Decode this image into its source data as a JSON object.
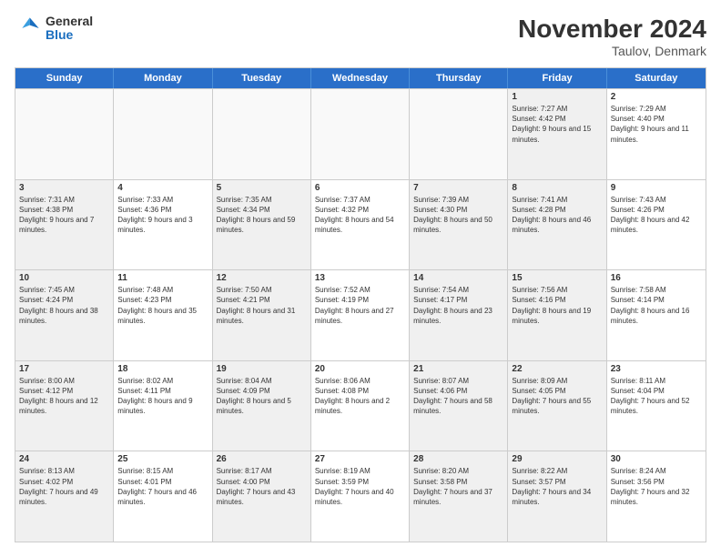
{
  "logo": {
    "line1": "General",
    "line2": "Blue"
  },
  "header": {
    "title": "November 2024",
    "subtitle": "Taulov, Denmark"
  },
  "weekdays": [
    "Sunday",
    "Monday",
    "Tuesday",
    "Wednesday",
    "Thursday",
    "Friday",
    "Saturday"
  ],
  "rows": [
    [
      {
        "day": "",
        "info": "",
        "empty": true
      },
      {
        "day": "",
        "info": "",
        "empty": true
      },
      {
        "day": "",
        "info": "",
        "empty": true
      },
      {
        "day": "",
        "info": "",
        "empty": true
      },
      {
        "day": "",
        "info": "",
        "empty": true
      },
      {
        "day": "1",
        "info": "Sunrise: 7:27 AM\nSunset: 4:42 PM\nDaylight: 9 hours and 15 minutes.",
        "shaded": true
      },
      {
        "day": "2",
        "info": "Sunrise: 7:29 AM\nSunset: 4:40 PM\nDaylight: 9 hours and 11 minutes.",
        "shaded": false
      }
    ],
    [
      {
        "day": "3",
        "info": "Sunrise: 7:31 AM\nSunset: 4:38 PM\nDaylight: 9 hours and 7 minutes.",
        "shaded": true
      },
      {
        "day": "4",
        "info": "Sunrise: 7:33 AM\nSunset: 4:36 PM\nDaylight: 9 hours and 3 minutes.",
        "shaded": false
      },
      {
        "day": "5",
        "info": "Sunrise: 7:35 AM\nSunset: 4:34 PM\nDaylight: 8 hours and 59 minutes.",
        "shaded": true
      },
      {
        "day": "6",
        "info": "Sunrise: 7:37 AM\nSunset: 4:32 PM\nDaylight: 8 hours and 54 minutes.",
        "shaded": false
      },
      {
        "day": "7",
        "info": "Sunrise: 7:39 AM\nSunset: 4:30 PM\nDaylight: 8 hours and 50 minutes.",
        "shaded": true
      },
      {
        "day": "8",
        "info": "Sunrise: 7:41 AM\nSunset: 4:28 PM\nDaylight: 8 hours and 46 minutes.",
        "shaded": true
      },
      {
        "day": "9",
        "info": "Sunrise: 7:43 AM\nSunset: 4:26 PM\nDaylight: 8 hours and 42 minutes.",
        "shaded": false
      }
    ],
    [
      {
        "day": "10",
        "info": "Sunrise: 7:45 AM\nSunset: 4:24 PM\nDaylight: 8 hours and 38 minutes.",
        "shaded": true
      },
      {
        "day": "11",
        "info": "Sunrise: 7:48 AM\nSunset: 4:23 PM\nDaylight: 8 hours and 35 minutes.",
        "shaded": false
      },
      {
        "day": "12",
        "info": "Sunrise: 7:50 AM\nSunset: 4:21 PM\nDaylight: 8 hours and 31 minutes.",
        "shaded": true
      },
      {
        "day": "13",
        "info": "Sunrise: 7:52 AM\nSunset: 4:19 PM\nDaylight: 8 hours and 27 minutes.",
        "shaded": false
      },
      {
        "day": "14",
        "info": "Sunrise: 7:54 AM\nSunset: 4:17 PM\nDaylight: 8 hours and 23 minutes.",
        "shaded": true
      },
      {
        "day": "15",
        "info": "Sunrise: 7:56 AM\nSunset: 4:16 PM\nDaylight: 8 hours and 19 minutes.",
        "shaded": true
      },
      {
        "day": "16",
        "info": "Sunrise: 7:58 AM\nSunset: 4:14 PM\nDaylight: 8 hours and 16 minutes.",
        "shaded": false
      }
    ],
    [
      {
        "day": "17",
        "info": "Sunrise: 8:00 AM\nSunset: 4:12 PM\nDaylight: 8 hours and 12 minutes.",
        "shaded": true
      },
      {
        "day": "18",
        "info": "Sunrise: 8:02 AM\nSunset: 4:11 PM\nDaylight: 8 hours and 9 minutes.",
        "shaded": false
      },
      {
        "day": "19",
        "info": "Sunrise: 8:04 AM\nSunset: 4:09 PM\nDaylight: 8 hours and 5 minutes.",
        "shaded": true
      },
      {
        "day": "20",
        "info": "Sunrise: 8:06 AM\nSunset: 4:08 PM\nDaylight: 8 hours and 2 minutes.",
        "shaded": false
      },
      {
        "day": "21",
        "info": "Sunrise: 8:07 AM\nSunset: 4:06 PM\nDaylight: 7 hours and 58 minutes.",
        "shaded": true
      },
      {
        "day": "22",
        "info": "Sunrise: 8:09 AM\nSunset: 4:05 PM\nDaylight: 7 hours and 55 minutes.",
        "shaded": true
      },
      {
        "day": "23",
        "info": "Sunrise: 8:11 AM\nSunset: 4:04 PM\nDaylight: 7 hours and 52 minutes.",
        "shaded": false
      }
    ],
    [
      {
        "day": "24",
        "info": "Sunrise: 8:13 AM\nSunset: 4:02 PM\nDaylight: 7 hours and 49 minutes.",
        "shaded": true
      },
      {
        "day": "25",
        "info": "Sunrise: 8:15 AM\nSunset: 4:01 PM\nDaylight: 7 hours and 46 minutes.",
        "shaded": false
      },
      {
        "day": "26",
        "info": "Sunrise: 8:17 AM\nSunset: 4:00 PM\nDaylight: 7 hours and 43 minutes.",
        "shaded": true
      },
      {
        "day": "27",
        "info": "Sunrise: 8:19 AM\nSunset: 3:59 PM\nDaylight: 7 hours and 40 minutes.",
        "shaded": false
      },
      {
        "day": "28",
        "info": "Sunrise: 8:20 AM\nSunset: 3:58 PM\nDaylight: 7 hours and 37 minutes.",
        "shaded": true
      },
      {
        "day": "29",
        "info": "Sunrise: 8:22 AM\nSunset: 3:57 PM\nDaylight: 7 hours and 34 minutes.",
        "shaded": true
      },
      {
        "day": "30",
        "info": "Sunrise: 8:24 AM\nSunset: 3:56 PM\nDaylight: 7 hours and 32 minutes.",
        "shaded": false
      }
    ]
  ]
}
